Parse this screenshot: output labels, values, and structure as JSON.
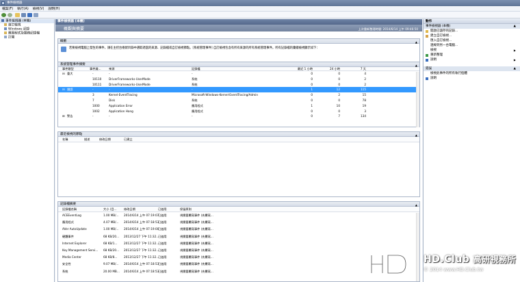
{
  "window": {
    "title": "事件檢視器"
  },
  "menu": [
    "檔案(F)",
    "執行(A)",
    "檢視(V)",
    "說明(H)"
  ],
  "tree": [
    {
      "label": "事件檢視器 (本機)",
      "indent": 0
    },
    {
      "label": "自訂檢視",
      "indent": 1
    },
    {
      "label": "Windows 記錄",
      "indent": 1
    },
    {
      "label": "應用程式及服務記錄檔",
      "indent": 1
    },
    {
      "label": "訂閱",
      "indent": 1
    }
  ],
  "center": {
    "header": "事件檢視器 (本機)",
    "subtitle": "概觀與摘要",
    "refresh": "上次重新整理時間: 2014/6/14 上午 09:46:50",
    "overview": {
      "title": "概觀",
      "text": "若要檢視電腦上發生的事件，請在主控台樹狀目錄中選取適當的來源、記錄檔或自訂檢視節點。[系統管理事件] 自訂檢視包含有所有來源的所有系統管理事件。所有記錄檔的彙總檢視顯示如下："
    },
    "summary": {
      "title": "系統管理事件摘要",
      "columns": [
        "事件類型",
        "事件識...",
        "來源",
        "記錄檔",
        "最近 1 小時",
        "24 小時",
        "7 天"
      ],
      "rows": [
        {
          "type": "重大",
          "id": "-",
          "source": "-",
          "log": "-",
          "h1": "0",
          "h24": "0",
          "d7": "4",
          "expander": "⊟"
        },
        {
          "type": "",
          "id": "10110",
          "source": "DriverFrameworks-UserMode",
          "log": "系統",
          "h1": "0",
          "h24": "0",
          "d7": "2",
          "expander": ""
        },
        {
          "type": "",
          "id": "10111",
          "source": "DriverFrameworks-UserMode",
          "log": "系統",
          "h1": "0",
          "h24": "0",
          "d7": "2",
          "expander": ""
        },
        {
          "type": "錯誤",
          "id": "-",
          "source": "-",
          "log": "-",
          "h1": "1",
          "h24": "12",
          "d7": "115",
          "expander": "⊟",
          "selected": true
        },
        {
          "type": "",
          "id": "3",
          "source": "Kernel-EventTracing",
          "log": "Microsoft-Windows-Kernel-EventTracing/Admin",
          "h1": "0",
          "h24": "2",
          "d7": "15",
          "expander": ""
        },
        {
          "type": "",
          "id": "7",
          "source": "Disk",
          "log": "系統",
          "h1": "0",
          "h24": "0",
          "d7": "78",
          "expander": ""
        },
        {
          "type": "",
          "id": "1000",
          "source": "Application Error",
          "log": "應用程式",
          "h1": "1",
          "h24": "10",
          "d7": "19",
          "expander": ""
        },
        {
          "type": "",
          "id": "1002",
          "source": "Application Hang",
          "log": "應用程式",
          "h1": "0",
          "h24": "0",
          "d7": "3",
          "expander": ""
        },
        {
          "type": "警告",
          "id": "-",
          "source": "-",
          "log": "-",
          "h1": "0",
          "h24": "7",
          "d7": "134",
          "expander": "⊞"
        }
      ]
    },
    "recent": {
      "title": "最近檢視的節點",
      "columns": [
        "名稱",
        "描述",
        "修改日期",
        "已建立"
      ]
    },
    "logsummary": {
      "title": "記錄檔摘要",
      "columns": [
        "記錄檔名稱",
        "大小 (目...",
        "修改日期",
        "已啟用",
        "保留原則"
      ],
      "rows": [
        {
          "name": "ACEEventLog",
          "size": "1.00 MB/...",
          "date": "2014/6/14 上午 07:19:07",
          "enabled": "已啟用",
          "policy": "視需要覆寫事件 (先覆寫..."
        },
        {
          "name": "應用程式",
          "size": "4.07 MB/...",
          "date": "2014/6/14 上午 07:18:53",
          "enabled": "已啟用",
          "policy": "視需要覆寫事件 (先覆寫..."
        },
        {
          "name": "AVer AutoUpdate",
          "size": "1.00 MB/...",
          "date": "2014/6/14 上午 07:19:00",
          "enabled": "已啟用",
          "policy": "視需要覆寫事件 (先覆寫..."
        },
        {
          "name": "硬體事件",
          "size": "68 KB/20...",
          "date": "2013/12/27 下午 11:32...",
          "enabled": "已啟用",
          "policy": "視需要覆寫事件 (先覆寫..."
        },
        {
          "name": "Internet Explorer",
          "size": "68 KB/1...",
          "date": "2013/12/27 下午 11:32...",
          "enabled": "已啟用",
          "policy": "視需要覆寫事件 (先覆寫..."
        },
        {
          "name": "Key Management Servi...",
          "size": "68 KB/20...",
          "date": "2013/12/27 下午 11:32...",
          "enabled": "已啟用",
          "policy": "視需要覆寫事件 (先覆寫..."
        },
        {
          "name": "Media Center",
          "size": "68 KB/8...",
          "date": "2013/12/27 下午 11:32...",
          "enabled": "已啟用",
          "policy": "視需要覆寫事件 (先覆寫..."
        },
        {
          "name": "安全性",
          "size": "9.07 MB/...",
          "date": "2014/6/14 上午 07:18:53",
          "enabled": "已啟用",
          "policy": "視需要覆寫事件 (先覆寫..."
        },
        {
          "name": "系統",
          "size": "20.00 MB...",
          "date": "2014/6/14 上午 07:18:53",
          "enabled": "已啟用",
          "policy": "視需要覆寫事件 (先覆寫..."
        }
      ]
    }
  },
  "actions": {
    "title": "動作",
    "group1": "事件檢視器 (本機)",
    "items1": [
      {
        "label": "開啟已儲存的記錄...",
        "icon": "folder-icon",
        "arrow": ""
      },
      {
        "label": "建立自訂檢視...",
        "icon": "filter-icon",
        "arrow": ""
      },
      {
        "label": "匯入自訂檢視...",
        "icon": "",
        "arrow": ""
      },
      {
        "label": "連線到另一台電腦...",
        "icon": "",
        "arrow": ""
      },
      {
        "label": "檢視",
        "icon": "",
        "arrow": "▶"
      },
      {
        "label": "重新整理",
        "icon": "refresh-icon",
        "arrow": ""
      },
      {
        "label": "說明",
        "icon": "help-icon",
        "arrow": "▶"
      }
    ],
    "group2": "錯誤",
    "items2": [
      {
        "label": "檢視此事件的所有執行個體",
        "icon": "",
        "arrow": ""
      },
      {
        "label": "說明",
        "icon": "help-icon",
        "arrow": ""
      }
    ]
  },
  "watermark": {
    "brand": "HD.Club",
    "cn": "高研視務所",
    "copy": "© 2014 www.HD.Club.tw"
  },
  "colors": {
    "accent": "#3399ff",
    "header": "#5f7597"
  }
}
